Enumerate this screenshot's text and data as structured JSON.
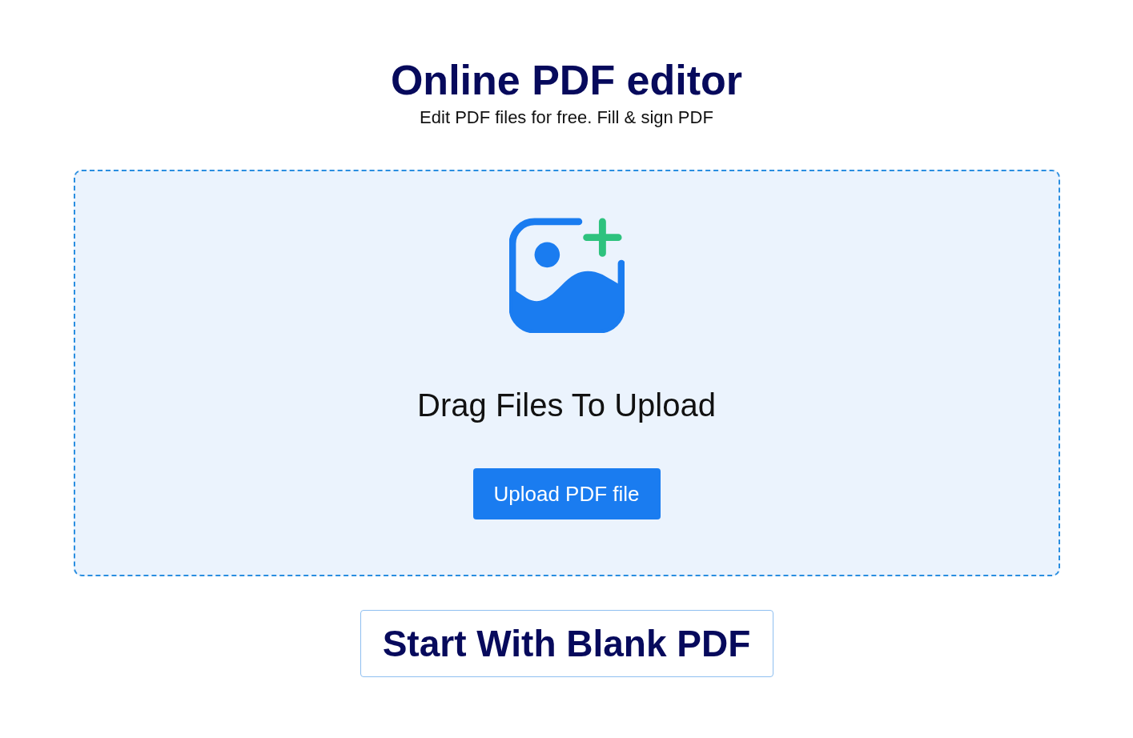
{
  "header": {
    "title": "Online PDF editor",
    "subtitle": "Edit PDF files for free. Fill & sign PDF"
  },
  "dropzone": {
    "prompt": "Drag Files To Upload",
    "button": "Upload PDF file"
  },
  "blank_button": "Start With Blank PDF"
}
